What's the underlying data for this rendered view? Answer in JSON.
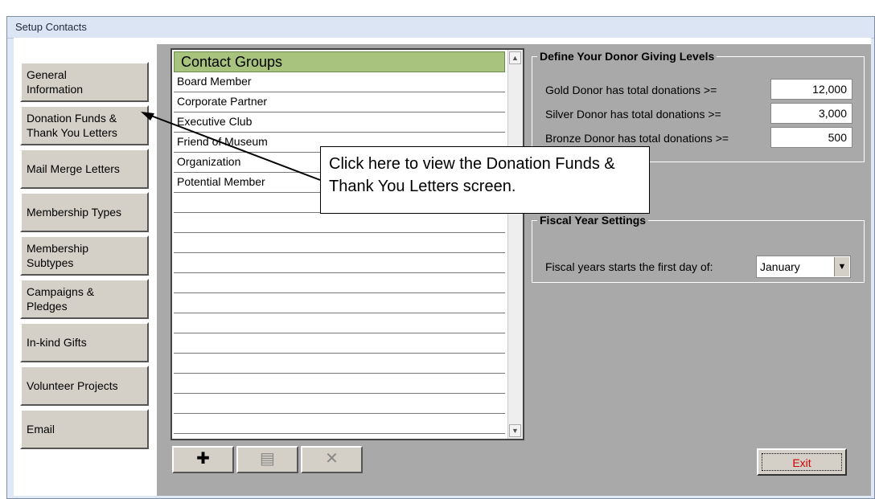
{
  "window": {
    "title": "Setup Contacts"
  },
  "nav": [
    {
      "label": "General\nInformation"
    },
    {
      "label": "Donation Funds &\nThank You Letters"
    },
    {
      "label": "Mail Merge Letters"
    },
    {
      "label": "Membership Types"
    },
    {
      "label": "Membership\nSubtypes"
    },
    {
      "label": "Campaigns &\nPledges"
    },
    {
      "label": "In-kind Gifts"
    },
    {
      "label": "Volunteer Projects"
    },
    {
      "label": "Email"
    }
  ],
  "contact_groups": {
    "header": "Contact Groups",
    "rows": [
      "Board Member",
      "Corporate Partner",
      "Executive Club",
      "Friend of Museum",
      "Organization",
      "Potential Member"
    ]
  },
  "toolbar": {
    "add_icon": "plus-icon",
    "edit_icon": "edit-document-icon",
    "delete_icon": "delete-x-icon"
  },
  "donor_levels": {
    "legend": "Define Your Donor Giving Levels",
    "gold_label": "Gold Donor has total donations >=",
    "gold_value": "12,000",
    "silver_label": "Silver Donor has total donations >=",
    "silver_value": "3,000",
    "bronze_label": "Bronze Donor has total donations >=",
    "bronze_value": "500"
  },
  "fiscal": {
    "legend": "Fiscal Year Settings",
    "label": "Fiscal years starts the first day of:",
    "month": "January"
  },
  "exit_label": "Exit",
  "callout": {
    "text": "Click here to view the Donation Funds & Thank You Letters screen."
  }
}
